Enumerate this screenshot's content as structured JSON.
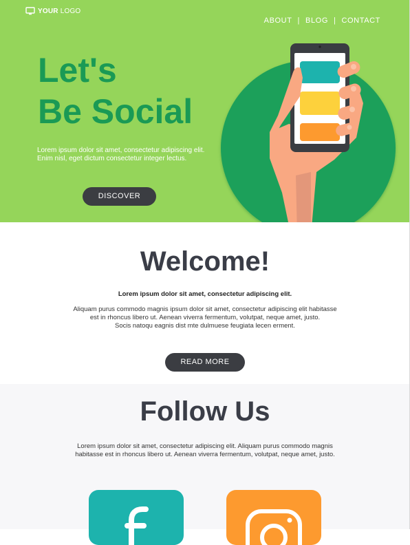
{
  "logo": {
    "strong": "YOUR",
    "rest": "LOGO"
  },
  "nav": {
    "about": "ABOUT",
    "blog": "BLOG",
    "contact": "CONTACT",
    "separator": "|"
  },
  "hero": {
    "title_line1": "Let's",
    "title_line2": "Be Social",
    "text_line1": "Lorem ipsum dolor sit amet, consectetur adipiscing elit.",
    "text_line2": "Enim nisl, eget dictum consectetur integer lectus.",
    "button": "DISCOVER"
  },
  "welcome": {
    "title": "Welcome!",
    "lead": "Lorem ipsum dolor sit amet, consectetur adipiscing elit.",
    "body_line1": "Aliquam purus commodo magnis ipsum dolor sit amet, consectetur adipiscing elit habitasse est in rhoncus libero ut. Aenean viverra fermentum, volutpat, neque amet, justo.",
    "body_line2": "Socis natoqu eagnis dist mte dulmuese feugiata lecen erment.",
    "button": "READ MORE"
  },
  "follow": {
    "title": "Follow Us",
    "body": "Lorem ipsum dolor sit amet, consectetur adipiscing elit. Aliquam purus commodo magnis habitasse est in rhoncus libero ut. Aenean viverra fermentum, volutpat, neque amet, justo."
  },
  "colors": {
    "hero_bg": "#95d55a",
    "brand_green": "#1a9a55",
    "dark_button": "#3b3d42",
    "heading": "#3a3d47",
    "teal": "#1db3ad",
    "orange": "#fd9a2f",
    "yellow": "#fdd13c"
  },
  "icons": {
    "logo": "monitor-icon",
    "facebook": "facebook-icon",
    "instagram": "instagram-icon"
  }
}
